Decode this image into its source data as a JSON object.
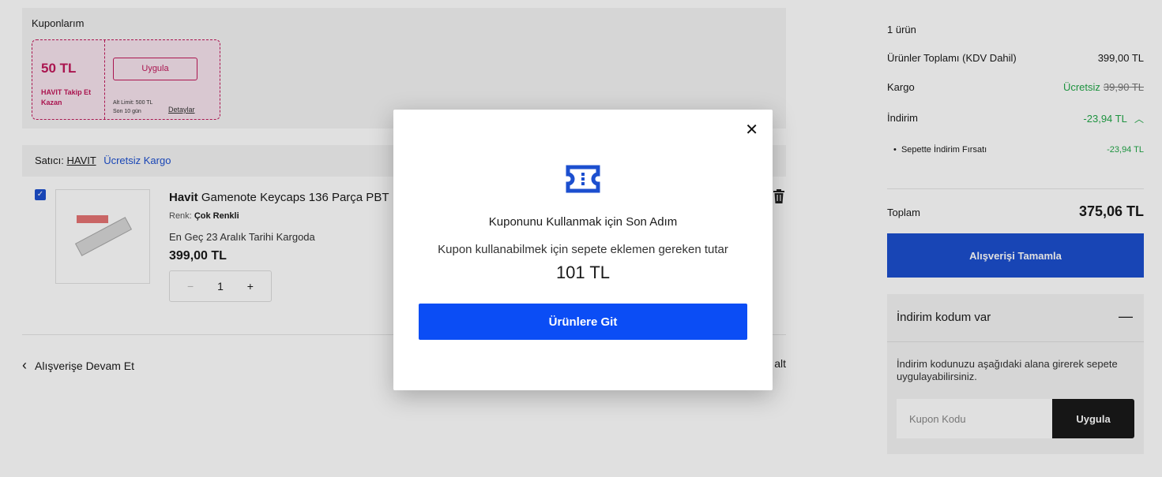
{
  "coupons": {
    "title": "Kuponlarım",
    "card": {
      "amount": "50 TL",
      "description": "HAVIT Takip Et Kazan",
      "apply_label": "Uygula",
      "limit": "Alt Limit: 500 TL",
      "days_left": "Son 10 gün",
      "details_label": "Detaylar"
    }
  },
  "seller": {
    "prefix": "Satıcı:",
    "name": "HAVIT",
    "shipping": "Ücretsiz Kargo"
  },
  "product": {
    "brand": "Havit",
    "name": " Gamenote Keycaps 136 Parça PBT",
    "color_label": "Renk:",
    "color_value": "Çok Renkli",
    "shipping_info": "En Geç 23 Aralık Tarihi Kargoda",
    "price": "399,00 TL",
    "quantity": "1",
    "minus": "−",
    "plus": "+"
  },
  "footer": {
    "continue_label": "Alışverişe Devam Et",
    "right_link_fragment": "alt"
  },
  "summary": {
    "count": "1 ürün",
    "products_total_label": "Ürünler Toplamı (KDV Dahil)",
    "products_total_value": "399,00 TL",
    "shipping_label": "Kargo",
    "shipping_free": "Ücretsiz",
    "shipping_old": "39,90 TL",
    "discount_label": "İndirim",
    "discount_value": "-23,94 TL",
    "discount_item_label": "Sepette İndirim Fırsatı",
    "discount_item_value": "-23,94 TL",
    "total_label": "Toplam",
    "total_value": "375,06 TL",
    "checkout_label": "Alışverişi Tamamla"
  },
  "discount_code": {
    "header": "İndirim kodum var",
    "collapse_icon": "—",
    "info": "İndirim kodunuzu aşağıdaki alana girerek sepete uygulayabilirsiniz.",
    "placeholder": "Kupon Kodu",
    "apply_label": "Uygula"
  },
  "modal": {
    "close": "✕",
    "title": "Kuponunu Kullanmak için Son Adım",
    "subtitle": "Kupon kullanabilmek için sepete eklemen gereken tutar",
    "amount": "101 TL",
    "button_label": "Ürünlere Git"
  },
  "colors": {
    "accent_blue": "#1c4fcf",
    "modal_button": "#0b4df5",
    "coupon_pink": "#c2185b",
    "discount_green": "#23a849"
  }
}
